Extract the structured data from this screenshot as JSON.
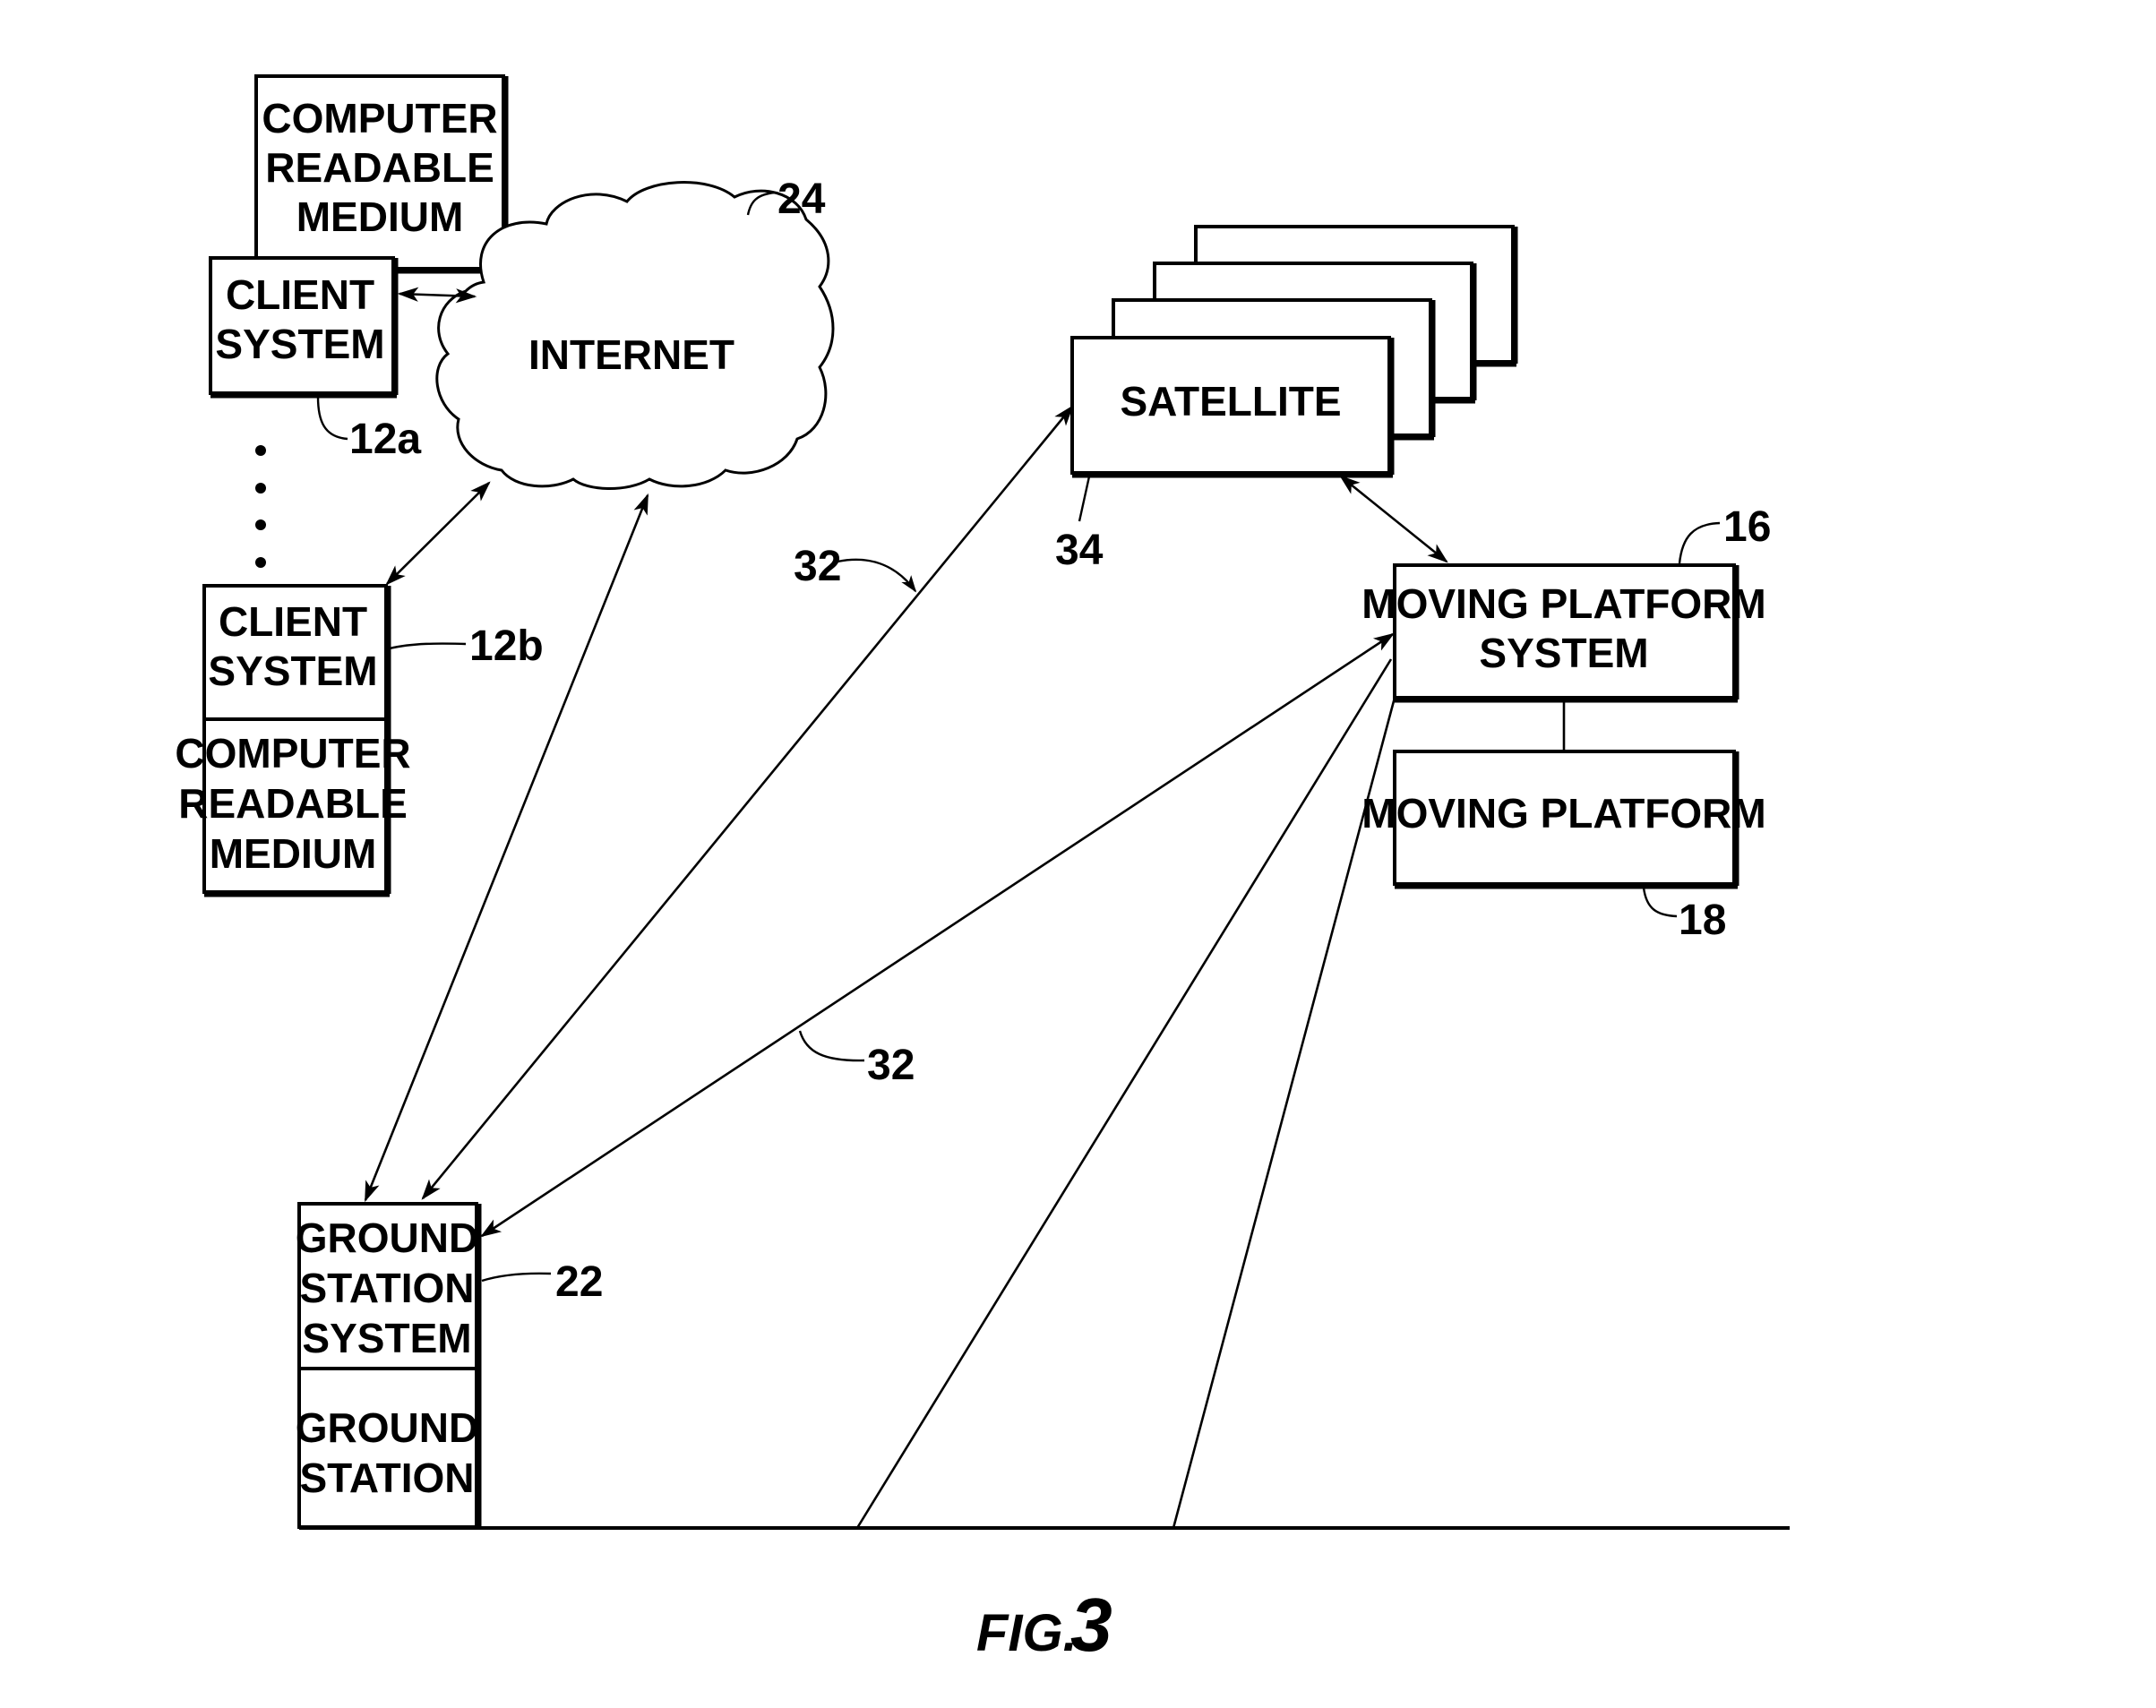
{
  "figure": {
    "caption_prefix": "FIG.",
    "caption_number": "3"
  },
  "nodes": {
    "crm_top": {
      "lines": [
        "COMPUTER",
        "READABLE",
        "MEDIUM"
      ]
    },
    "client_a": {
      "lines": [
        "CLIENT",
        "SYSTEM"
      ],
      "ref": "12a"
    },
    "internet": {
      "label": "INTERNET",
      "ref": "24"
    },
    "client_b": {
      "lines": [
        "CLIENT",
        "SYSTEM"
      ],
      "ref": "12b"
    },
    "crm_bottom": {
      "lines": [
        "COMPUTER",
        "READABLE",
        "MEDIUM"
      ]
    },
    "satellite": {
      "label": "SATELLITE",
      "ref": "34"
    },
    "moving_platform_system": {
      "lines": [
        "MOVING PLATFORM",
        "SYSTEM"
      ],
      "ref": "16"
    },
    "moving_platform": {
      "label": "MOVING PLATFORM",
      "ref": "18"
    },
    "ground_station_system": {
      "lines": [
        "GROUND",
        "STATION",
        "SYSTEM"
      ],
      "ref": "22"
    },
    "ground_station": {
      "lines": [
        "GROUND",
        "STATION"
      ]
    }
  },
  "links": {
    "upper_ref": "32",
    "lower_ref": "32"
  }
}
